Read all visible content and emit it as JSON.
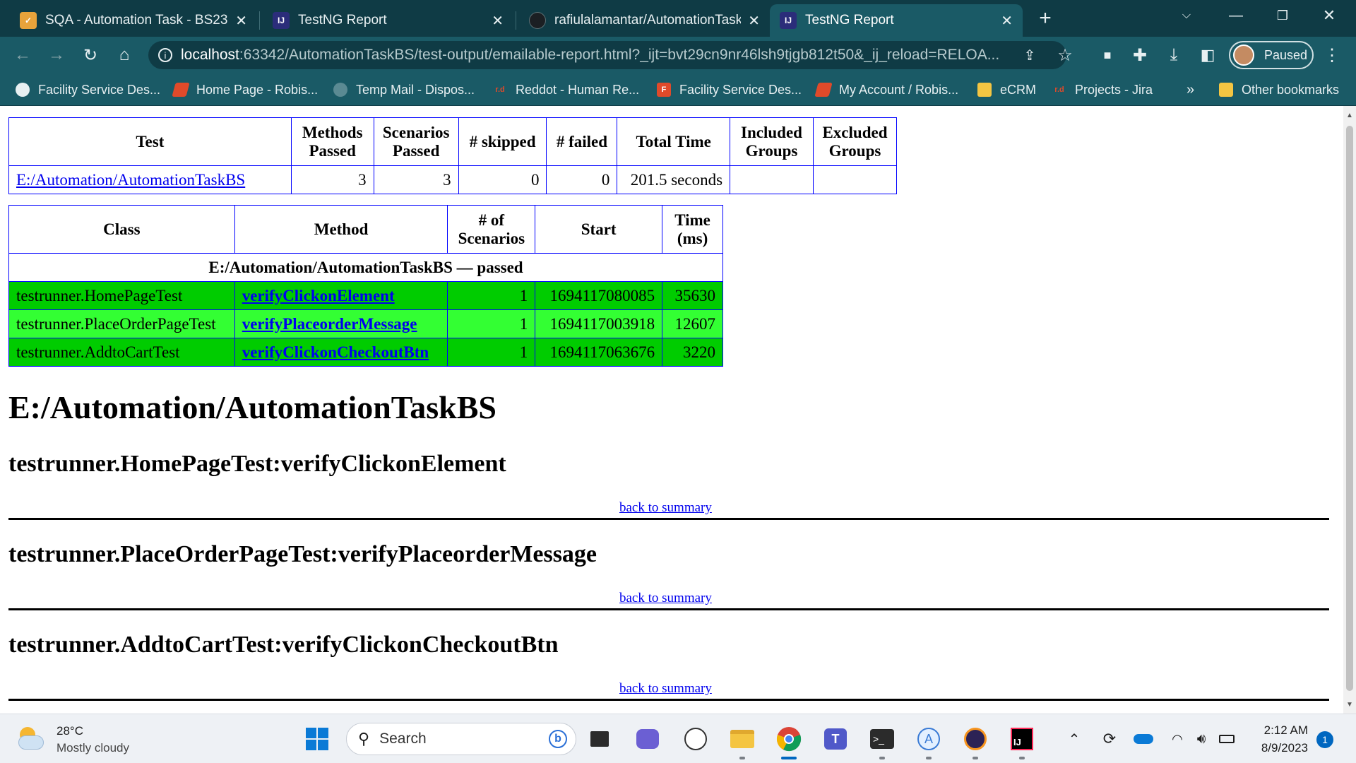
{
  "browser": {
    "tabs": [
      {
        "title": "SQA - Automation Task - BS23 - ",
        "icon": "clickup-favicon-icon",
        "color": "#e8a33b"
      },
      {
        "title": "TestNG Report",
        "icon": "intellij-favicon-icon",
        "color": "#2b2d7a"
      },
      {
        "title": "rafiulalamantar/AutomationTaskB",
        "icon": "github-favicon-icon",
        "color": "#1b1f23"
      },
      {
        "title": "TestNG Report",
        "icon": "intellij-favicon-icon",
        "color": "#2b2d7a"
      }
    ],
    "new_tab_label": "+",
    "url_host": "localhost",
    "url_path": ":63342/AutomationTaskBS/test-output/emailable-report.html?_ijt=bvt29cn9nr46lsh9tjgb812t50&_ij_reload=RELOA...",
    "profile_label": "Paused",
    "bookmarks": [
      {
        "label": "Facility Service Des...",
        "icon": "globe-icon"
      },
      {
        "label": "Home Page - Robis...",
        "icon": "robi-icon"
      },
      {
        "label": "Temp Mail - Dispos...",
        "icon": "tempmail-icon"
      },
      {
        "label": "Reddot - Human Re...",
        "icon": "reddot-icon"
      },
      {
        "label": "Facility Service Des...",
        "icon": "fsd-icon"
      },
      {
        "label": "My Account / Robis...",
        "icon": "robi-icon"
      },
      {
        "label": "eCRM",
        "icon": "folder-icon"
      },
      {
        "label": "Projects - Jira",
        "icon": "reddot-icon"
      }
    ],
    "overflow_label": "»",
    "other_bookmarks": "Other bookmarks"
  },
  "summary_table": {
    "headers": [
      "Test",
      "Methods Passed",
      "Scenarios Passed",
      "# skipped",
      "# failed",
      "Total Time",
      "Included Groups",
      "Excluded Groups"
    ],
    "row": {
      "test": "E:/Automation/AutomationTaskBS",
      "methods_passed": "3",
      "scenarios_passed": "3",
      "skipped": "0",
      "failed": "0",
      "total_time": "201.5 seconds",
      "included_groups": "",
      "excluded_groups": ""
    }
  },
  "methods_table": {
    "headers": [
      "Class",
      "Method",
      "# of Scenarios",
      "Start",
      "Time (ms)"
    ],
    "group_label": "E:/Automation/AutomationTaskBS — passed",
    "rows": [
      {
        "class": "testrunner.HomePageTest",
        "method": "verifyClickonElement",
        "scenarios": "1",
        "start": "1694117080085",
        "time": "35630"
      },
      {
        "class": "testrunner.PlaceOrderPageTest",
        "method": "verifyPlaceorderMessage",
        "scenarios": "1",
        "start": "1694117003918",
        "time": "12607"
      },
      {
        "class": "testrunner.AddtoCartTest",
        "method": "verifyClickonCheckoutBtn",
        "scenarios": "1",
        "start": "1694117063676",
        "time": "3220"
      }
    ],
    "row_colors": [
      "#00cc00",
      "#33ff33"
    ]
  },
  "details": {
    "title": "E:/Automation/AutomationTaskBS",
    "sections": [
      {
        "heading": "testrunner.HomePageTest:verifyClickonElement",
        "back_link": "back to summary"
      },
      {
        "heading": "testrunner.PlaceOrderPageTest:verifyPlaceorderMessage",
        "back_link": "back to summary"
      },
      {
        "heading": "testrunner.AddtoCartTest:verifyClickonCheckoutBtn",
        "back_link": "back to summary"
      }
    ]
  },
  "taskbar": {
    "weather_temp": "28°C",
    "weather_desc": "Mostly cloudy",
    "search_placeholder": "Search",
    "clock_time": "2:12 AM",
    "clock_date": "8/9/2023",
    "notification_count": "1"
  },
  "colors": {
    "chrome_dark": "#0f3b45",
    "chrome_toolbar": "#1a5a66",
    "table_border": "#0000ff",
    "link": "#0000ee"
  }
}
